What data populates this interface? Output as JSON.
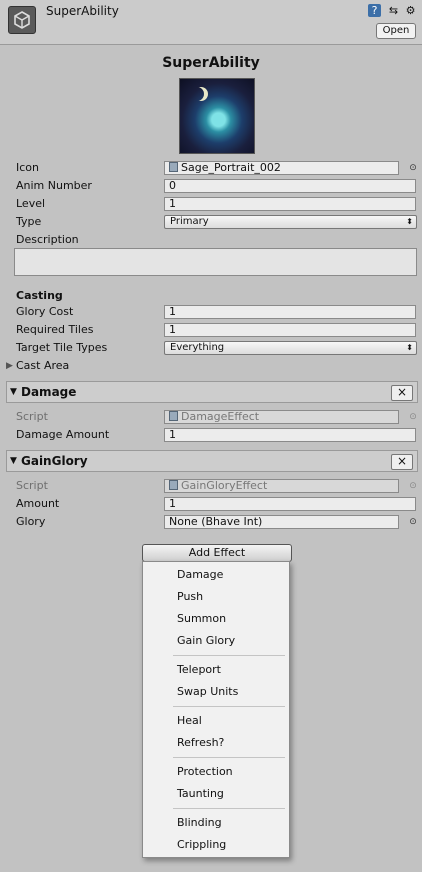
{
  "header": {
    "title": "SuperAbility",
    "open_label": "Open"
  },
  "title": "SuperAbility",
  "fields": {
    "icon": {
      "label": "Icon",
      "value": "Sage_Portrait_002"
    },
    "anim_number": {
      "label": "Anim Number",
      "value": "0"
    },
    "level": {
      "label": "Level",
      "value": "1"
    },
    "type": {
      "label": "Type",
      "value": "Primary"
    },
    "description": {
      "label": "Description",
      "value": ""
    }
  },
  "casting": {
    "heading": "Casting",
    "glory_cost": {
      "label": "Glory Cost",
      "value": "1"
    },
    "required_tiles": {
      "label": "Required Tiles",
      "value": "1"
    },
    "target_tile_types": {
      "label": "Target Tile Types",
      "value": "Everything"
    },
    "cast_area": {
      "label": "Cast Area"
    }
  },
  "damage": {
    "name": "Damage",
    "script_label": "Script",
    "script_value": "DamageEffect",
    "amount_label": "Damage Amount",
    "amount_value": "1"
  },
  "gain_glory": {
    "name": "GainGlory",
    "script_label": "Script",
    "script_value": "GainGloryEffect",
    "amount_label": "Amount",
    "amount_value": "1",
    "glory_label": "Glory",
    "glory_value": "None (Bhave Int)"
  },
  "add_effect_label": "Add Effect",
  "menu": {
    "groups": [
      [
        "Damage",
        "Push",
        "Summon",
        "Gain Glory"
      ],
      [
        "Teleport",
        "Swap Units"
      ],
      [
        "Heal",
        "Refresh?"
      ],
      [
        "Protection",
        "Taunting"
      ],
      [
        "Blinding",
        "Crippling"
      ]
    ]
  },
  "icons": [
    "unity-logo-icon",
    "help-book-icon",
    "settings-sliders-icon",
    "gear-icon",
    "object-picker-icon",
    "script-icon",
    "close-icon",
    "foldout-arrow-icon"
  ]
}
